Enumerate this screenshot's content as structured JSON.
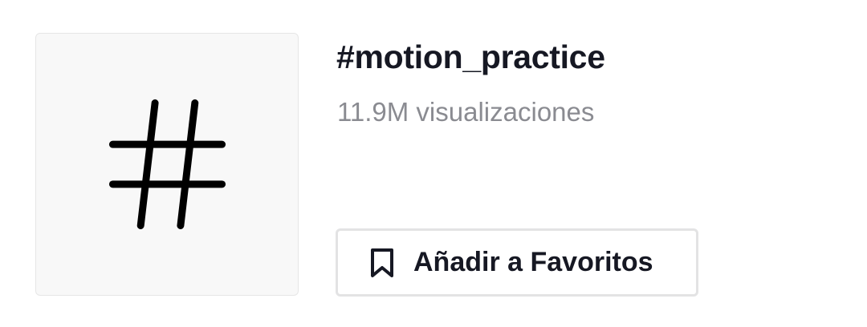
{
  "hashtag": {
    "title": "#motion_practice",
    "views": "11.9M visualizaciones",
    "cover_icon": "hashtag-icon"
  },
  "favorite_button": {
    "label": "Añadir a Favoritos",
    "icon": "bookmark-icon"
  },
  "colors": {
    "title": "#161823",
    "secondary_text": "#8a8b91",
    "cover_background": "#f8f8f8",
    "button_border": "#e3e3e4"
  }
}
